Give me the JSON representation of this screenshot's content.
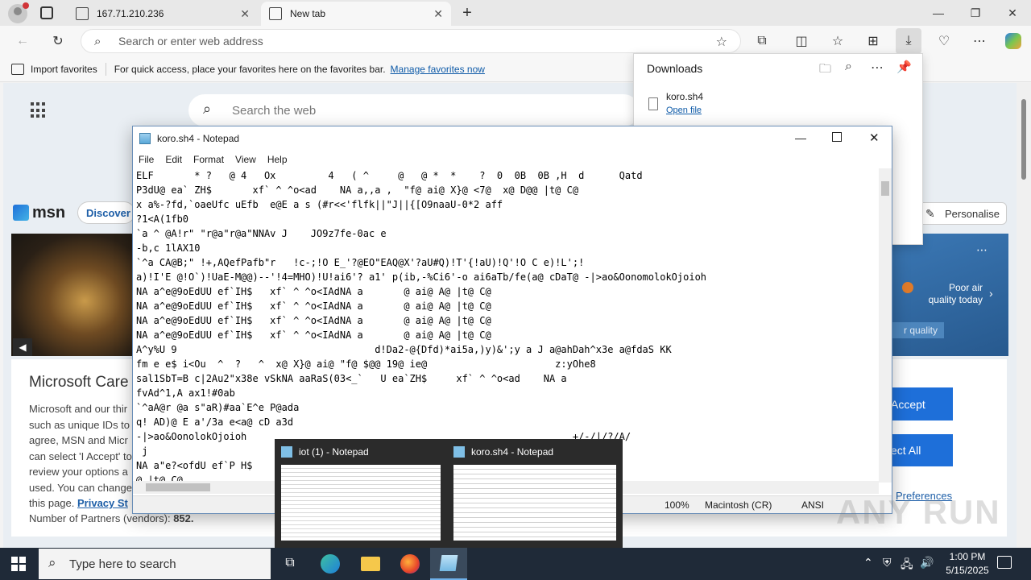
{
  "browser": {
    "tabs": [
      {
        "label": "167.71.210.236"
      },
      {
        "label": "New tab"
      }
    ],
    "address_placeholder": "Search or enter web address",
    "favorites": {
      "import_label": "Import favorites",
      "hint": "For quick access, place your favorites here on the favorites bar.",
      "manage_link": "Manage favorites now"
    }
  },
  "newtab": {
    "search_placeholder": "Search the web",
    "msn_label": "msn",
    "discover_label": "Discover",
    "personalise_label": "Personalise",
    "weather_text": "Poor air quality today",
    "air_quality_chip": "r quality",
    "cookie": {
      "heading": "Microsoft Care",
      "body_lines": [
        "Microsoft and our thir",
        "such as unique IDs to",
        "agree, MSN and Micr",
        "can select 'I Accept' to",
        "review your options a",
        "used. You can change",
        "this page."
      ],
      "privacy_link": "Privacy St",
      "partners_label": "Number of Partners (vendors):",
      "partners_count": "852.",
      "accept_label": "Accept",
      "reject_label": "ect All",
      "preferences_label": "Preferences"
    }
  },
  "downloads": {
    "title": "Downloads",
    "file_name": "koro.sh4",
    "open_link": "Open file"
  },
  "notepad": {
    "title": "koro.sh4 - Notepad",
    "menu": [
      "File",
      "Edit",
      "Format",
      "View",
      "Help"
    ],
    "lines": [
      "ELF       * ?   @ 4   Ox         4   ( ^     @   @ *  *    ?  0  0B  0B ,H  d      Qatd",
      "P3dU@ ea` ZH$       xf` ^ ^o<ad    NA a,,a ,  \"f@ ai@ X}@ <7@  x@ D@@ |t@ C@",
      "x a%-?fd,`oaeUfc uEfb  e@E a s (#r<<'flfk||\"J||{[O9naaU-0*2 aff",
      "?1<A(1fb0",
      "`a ^ @A!r\" \"r@a\"r@a\"NNAv J    JO9z7fe-0ac e",
      "-b,c 1lAX10",
      "`^a CA@B;\" !+,AQefPafb\"r   !c-;!O E_'?@EO\"EAQ@X'?aU#Q)!T'{!aU)!Q'!O C e)!L';!",
      "a)!I'E @!O`)!UaE-M@@)--'!4=MHO)!U!ai6'? a1' p(ib,-%Ci6'-o ai6aTb/fe(a@ cDaT@ -|>ao&OonomolokOjoioh",
      "NA a^e@9oEdUU ef`IH$   xf` ^ ^o<IAdNA a       @ ai@ A@ |t@ C@",
      "NA a^e@9oEdUU ef`IH$   xf` ^ ^o<IAdNA a       @ ai@ A@ |t@ C@",
      "NA a^e@9oEdUU ef`IH$   xf` ^ ^o<IAdNA a       @ ai@ A@ |t@ C@",
      "NA a^e@9oEdUU ef`IH$   xf` ^ ^o<IAdNA a       @ ai@ A@ |t@ C@",
      "A^y%U 9                                  d!Da2-@{Dfd)*ai5a,)y)&';y a J a@ahDah^x3e a@fdaS KK",
      "fm e e$ i<Ou  ^  ?   ^  x@ X}@ ai@ \"f@ $@@ 19@ ie@                      z:yOhe8",
      "sal1SbT=B c|2Au2\"x38e vSkNA aaRaS(03<_`   U ea`ZH$     xf` ^ ^o<ad    NA a",
      "fvAd^1,A ax1!#0ab",
      "`^aA@r @a s\"aR)#aa`E^e P@ada",
      "q! AD)@ E a'/3a e<a@ cD a3d",
      "-|>ao&OonolokOjoioh                                                        +/-/|/?/A/",
      " j",
      "NA a\"e?<ofdU ef`P H$",
      "@ |t@ C@"
    ],
    "status_zoom": "100%",
    "status_eol": "Macintosh (CR)",
    "status_enc": "ANSI"
  },
  "taskbar": {
    "search_placeholder": "Type here to search",
    "time": "1:00 PM",
    "date": "5/15/2025",
    "thumbs": [
      {
        "label": "iot (1) - Notepad"
      },
      {
        "label": "koro.sh4 - Notepad"
      }
    ]
  },
  "watermark": "ANY RUN"
}
